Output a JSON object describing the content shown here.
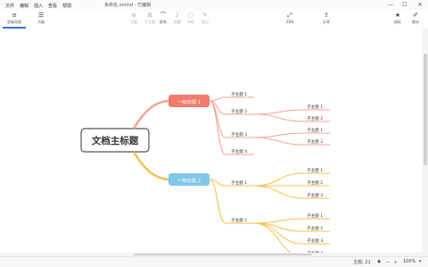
{
  "menu": [
    "文件",
    "编辑",
    "插入",
    "查看",
    "帮助"
  ],
  "document_title": "未命名.xmind - 已编辑",
  "window_buttons": {
    "minimize": "—",
    "maximize": "☐",
    "close": "✕"
  },
  "toolbar": {
    "view_outline": {
      "icon": "outline-icon",
      "label": "思维导图"
    },
    "view_text": {
      "icon": "list-icon",
      "label": "大纲"
    },
    "center": [
      {
        "name": "topic",
        "label": "主题",
        "enabled": false
      },
      {
        "name": "subtopic",
        "label": "子主题",
        "enabled": false
      },
      {
        "name": "relation",
        "label": "联系",
        "enabled": true
      },
      {
        "name": "summary",
        "label": "概要",
        "enabled": false
      },
      {
        "name": "boundary",
        "label": "外框",
        "enabled": false
      },
      {
        "name": "mark",
        "label": "笔记",
        "enabled": false
      }
    ],
    "zen": "ZEN",
    "share": "分享",
    "icon_label": "图标",
    "format_label": "格式"
  },
  "mindmap": {
    "central": "文档主标题",
    "branches": [
      {
        "label": "一级标题 1",
        "color": "#f17c6d",
        "line": "#f2a593",
        "subs": [
          {
            "label": "子主题 1",
            "children": []
          },
          {
            "label": "子主题 2",
            "children": [
              "子主题 1",
              "子主题 2"
            ]
          },
          {
            "label": "子主题 3",
            "children": [
              "子主题 1",
              "子主题 2"
            ]
          },
          {
            "label": "子主题 4",
            "children": []
          }
        ]
      },
      {
        "label": "一级标题 2",
        "color": "#7fc8ea",
        "line": "#f4c046",
        "subs": [
          {
            "label": "子主题 1",
            "children": [
              "子主题 1",
              "子主题 2",
              "子主题 3"
            ]
          },
          {
            "label": "子主题 2",
            "children": [
              "子主题 1",
              "子主题 2",
              "子主题 3",
              "子主题 4"
            ]
          }
        ]
      }
    ]
  },
  "status": {
    "topic_count": "主题: 21",
    "zoom": "100%",
    "zoom_minus": "－",
    "zoom_plus": "＋"
  }
}
